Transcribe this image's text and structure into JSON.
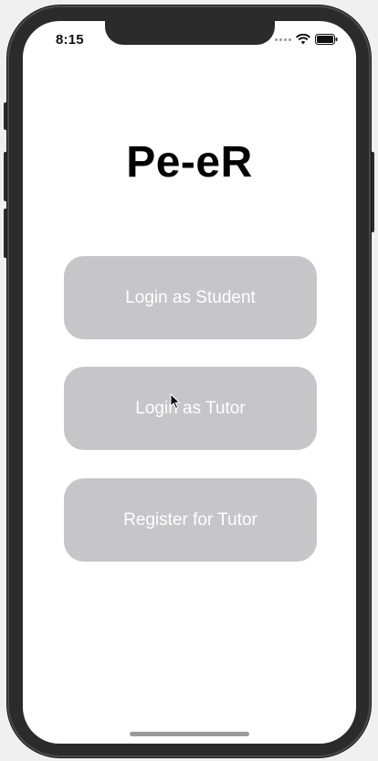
{
  "status_bar": {
    "time": "8:15",
    "icons": [
      "cellular-signal-icon",
      "wifi-icon",
      "battery-icon"
    ]
  },
  "app": {
    "title": "Pe-eR"
  },
  "buttons": {
    "login_student": "Login as Student",
    "login_tutor": "Login as Tutor",
    "register_tutor": "Register for Tutor"
  },
  "colors": {
    "button_bg": "#c6c6c8",
    "button_text": "#ffffff",
    "screen_bg": "#ffffff",
    "device_frame": "#2b2b2b"
  }
}
